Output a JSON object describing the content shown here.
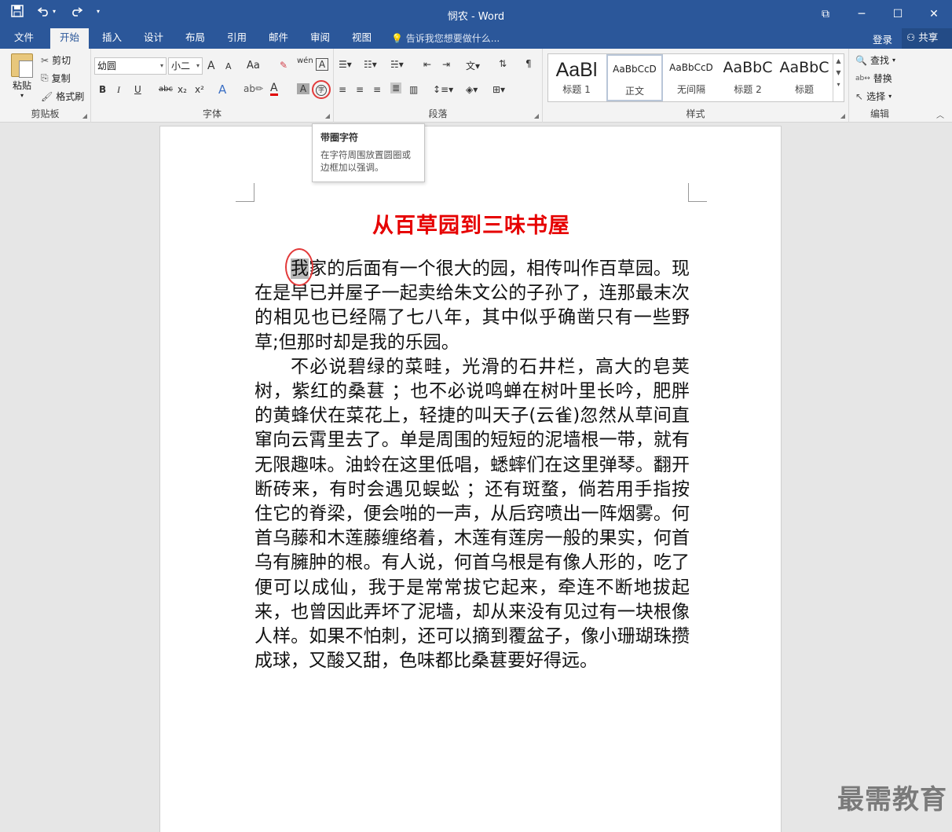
{
  "window": {
    "title": "悯农 - Word",
    "minimize": "─",
    "restore": "☐",
    "close": "✕",
    "ribbon_display": "⧉"
  },
  "qat": {
    "save_icon": "save-icon",
    "undo_icon": "undo-icon",
    "redo_icon": "redo-icon",
    "customize_icon": "customize-icon"
  },
  "tabs": [
    {
      "label": "文件"
    },
    {
      "label": "开始"
    },
    {
      "label": "插入"
    },
    {
      "label": "设计"
    },
    {
      "label": "布局"
    },
    {
      "label": "引用"
    },
    {
      "label": "邮件"
    },
    {
      "label": "审阅"
    },
    {
      "label": "视图"
    }
  ],
  "tell_me": "告诉我您想要做什么...",
  "account": {
    "login": "登录",
    "share": "共享"
  },
  "clipboard": {
    "paste": "粘贴",
    "cut": "剪切",
    "copy": "复制",
    "format_painter": "格式刷",
    "group": "剪贴板"
  },
  "font": {
    "name": "幼圆",
    "size": "小二",
    "grow": "A",
    "shrink": "A",
    "case": "Aa",
    "group": "字体",
    "bold": "B",
    "italic": "I",
    "underline": "U",
    "strike": "abc",
    "sub": "x₂",
    "sup": "x²",
    "pinyin": "wén",
    "border": "A",
    "effects": "A",
    "color": "A",
    "shading": "A",
    "enclose": "字"
  },
  "paragraph": {
    "group": "段落"
  },
  "styles": {
    "group": "样式",
    "items": [
      {
        "sample": "AaBl",
        "name": "标题 1"
      },
      {
        "sample": "AaBbCcD",
        "name": "正文"
      },
      {
        "sample": "AaBbCcD",
        "name": "无间隔"
      },
      {
        "sample": "AaBbC",
        "name": "标题 2"
      },
      {
        "sample": "AaBbC",
        "name": "标题"
      }
    ]
  },
  "editing": {
    "find": "查找",
    "replace": "替换",
    "select": "选择",
    "group": "编辑"
  },
  "tooltip": {
    "title": "带圈字符",
    "desc": "在字符周围放置圆圈或边框加以强调。"
  },
  "document": {
    "title": "从百草园到三味书屋",
    "first_char": "我",
    "p1_rest": "家的后面有一个很大的园，相传叫作百草园。现在是早已并屋子一起卖给朱文公的子孙了，连那最末次的相见也已经隔了七八年，其中似乎确凿只有一些野草;但那时却是我的乐园。",
    "p2": "不必说碧绿的菜畦，光滑的石井栏，高大的皂荚树，紫红的桑葚 ；也不必说鸣蝉在树叶里长吟，肥胖的黄蜂伏在菜花上，轻捷的叫天子(云雀)忽然从草间直窜向云霄里去了。单是周围的短短的泥墙根一带，就有无限趣味。油蛉在这里低唱，蟋蟀们在这里弹琴。翻开断砖来，有时会遇见蜈蚣 ；还有斑蝥，倘若用手指按住它的脊梁，便会啪的一声，从后窍喷出一阵烟雾。何首乌藤和木莲藤缠络着，木莲有莲房一般的果实，何首乌有臃肿的根。有人说，何首乌根是有像人形的，吃了便可以成仙，我于是常常拔它起来，牵连不断地拔起来，也曾因此弄坏了泥墙，却从来没有见过有一块根像人样。如果不怕刺，还可以摘到覆盆子，像小珊瑚珠攒成球，又酸又甜，色味都比桑葚要好得远。"
  },
  "watermark": "最需教育"
}
